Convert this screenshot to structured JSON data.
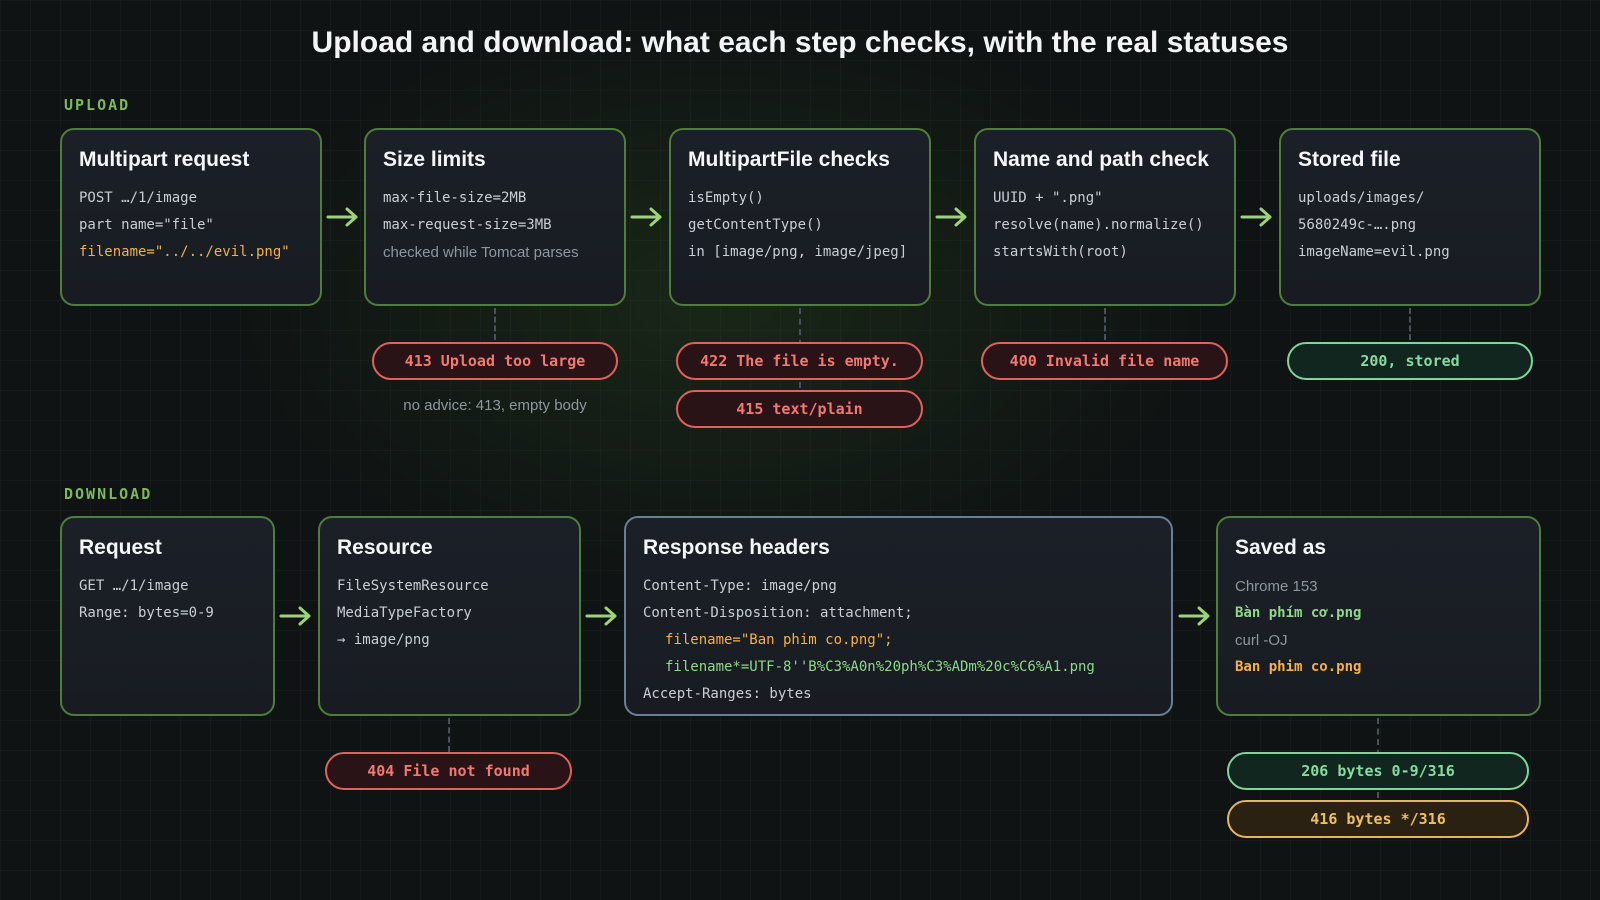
{
  "title": "Upload and download: what each step checks, with the real statuses",
  "colors": {
    "accent_green": "#9fd37a",
    "error_red": "#e0625c",
    "ok_green": "#7fd59a",
    "warn_amber": "#e8b65a",
    "code_orange": "#f5b04b"
  },
  "upload": {
    "label": "UPLOAD",
    "steps": [
      {
        "title": "Multipart request",
        "lines": [
          "POST …/1/image",
          "part name=\"file\"",
          "filename=\"../../evil.png\""
        ]
      },
      {
        "title": "Size limits",
        "lines": [
          "max-file-size=2MB",
          "max-request-size=3MB",
          "checked while Tomcat parses"
        ]
      },
      {
        "title": "MultipartFile checks",
        "lines": [
          "isEmpty()",
          "getContentType()",
          "in [image/png, image/jpeg]"
        ]
      },
      {
        "title": "Name and path check",
        "lines": [
          "UUID + \".png\"",
          "resolve(name).normalize()",
          "startsWith(root)"
        ]
      },
      {
        "title": "Stored file",
        "lines": [
          "uploads/images/",
          "5680249c-….png",
          "imageName=evil.png"
        ]
      }
    ],
    "statuses": {
      "size": "413 Upload too large",
      "size_note": "no advice: 413, empty body",
      "empty": "422 The file is empty.",
      "type": "415 text/plain",
      "name": "400 Invalid file name",
      "stored": "200, stored"
    }
  },
  "download": {
    "label": "DOWNLOAD",
    "steps": [
      {
        "title": "Request",
        "lines": [
          "GET …/1/image",
          "Range: bytes=0-9"
        ]
      },
      {
        "title": "Resource",
        "lines": [
          "FileSystemResource",
          "MediaTypeFactory",
          "→ image/png"
        ]
      },
      {
        "title": "Response headers",
        "lines": [
          "Content-Type: image/png",
          "Content-Disposition: attachment;",
          "filename=\"Ban phim co.png\";",
          "filename*=UTF-8''B%C3%A0n%20ph%C3%ADm%20c%C6%A1.png",
          "Accept-Ranges: bytes"
        ]
      },
      {
        "title": "Saved as",
        "lines": [
          "Chrome 153",
          "Bàn phím cơ.png",
          "curl -OJ",
          "Ban phim co.png"
        ]
      }
    ],
    "statuses": {
      "not_found": "404 File not found",
      "partial": "206 bytes 0-9/316",
      "range_bad": "416 bytes */316"
    }
  }
}
